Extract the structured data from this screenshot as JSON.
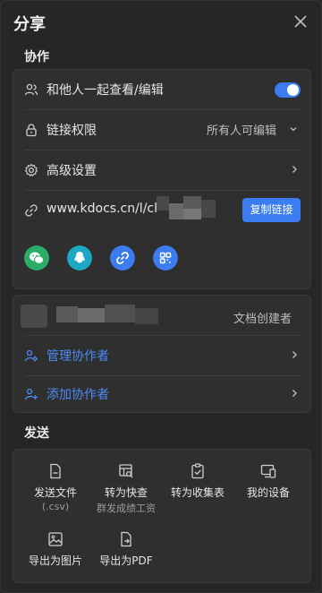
{
  "header": {
    "title": "分享",
    "close_icon": "close-icon"
  },
  "collab": {
    "section_label": "协作",
    "rows": {
      "together": {
        "label": "和他人一起查看/编辑",
        "icon": "people-icon",
        "toggle_on": true
      },
      "permission": {
        "label": "链接权限",
        "icon": "lock-icon",
        "value": "所有人可编辑"
      },
      "advanced": {
        "label": "高级设置",
        "icon": "gear-icon"
      },
      "link": {
        "label": "www.kdocs.cn/l/cl",
        "icon": "link-icon",
        "copy_label": "复制链接"
      }
    },
    "share_targets": [
      {
        "name": "wechat",
        "icon": "wechat-icon",
        "color": "#2aae67"
      },
      {
        "name": "qq",
        "icon": "qq-penguin-icon",
        "color": "#1fa8c5"
      },
      {
        "name": "copy-link",
        "icon": "chain-link-icon",
        "color": "#3b7cf0"
      },
      {
        "name": "qrcode",
        "icon": "qrcode-icon",
        "color": "#3b7cf0"
      }
    ]
  },
  "collaborators": {
    "owner_role": "文档创建者",
    "manage_label": "管理协作者",
    "add_label": "添加协作者"
  },
  "send": {
    "section_label": "发送",
    "items": [
      {
        "label": "发送文件",
        "sub": "(.csv)",
        "icon": "file-icon"
      },
      {
        "label": "转为快查",
        "sub": "群发成绩工资",
        "icon": "table-search-icon"
      },
      {
        "label": "转为收集表",
        "sub": "",
        "icon": "clipboard-check-icon"
      },
      {
        "label": "我的设备",
        "sub": "",
        "icon": "devices-icon"
      },
      {
        "label": "导出为图片",
        "sub": "",
        "icon": "image-icon"
      },
      {
        "label": "导出为PDF",
        "sub": "",
        "icon": "export-pdf-icon"
      }
    ]
  },
  "colors": {
    "accent": "#3b7cf0",
    "background": "#262626",
    "card": "#2f2f2f"
  }
}
